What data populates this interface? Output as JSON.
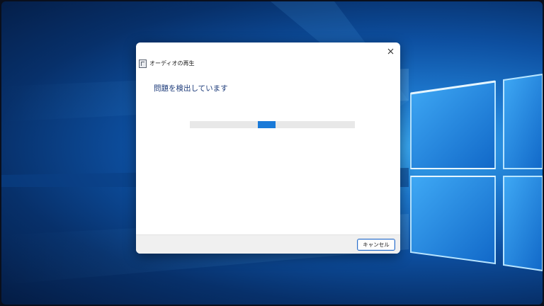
{
  "dialog": {
    "app_title": "オーディオの再生",
    "heading": "問題を検出しています",
    "cancel_label": "キャンセル",
    "close_icon": "close-icon",
    "app_icon": "troubleshooter-icon"
  },
  "progress": {
    "indeterminate": true,
    "accent": "#1a7ad8",
    "track": "#e8e8e8"
  },
  "colors": {
    "heading": "#1d3b7a",
    "button_border": "#2c6fc9",
    "footer": "#f0f0f0"
  }
}
